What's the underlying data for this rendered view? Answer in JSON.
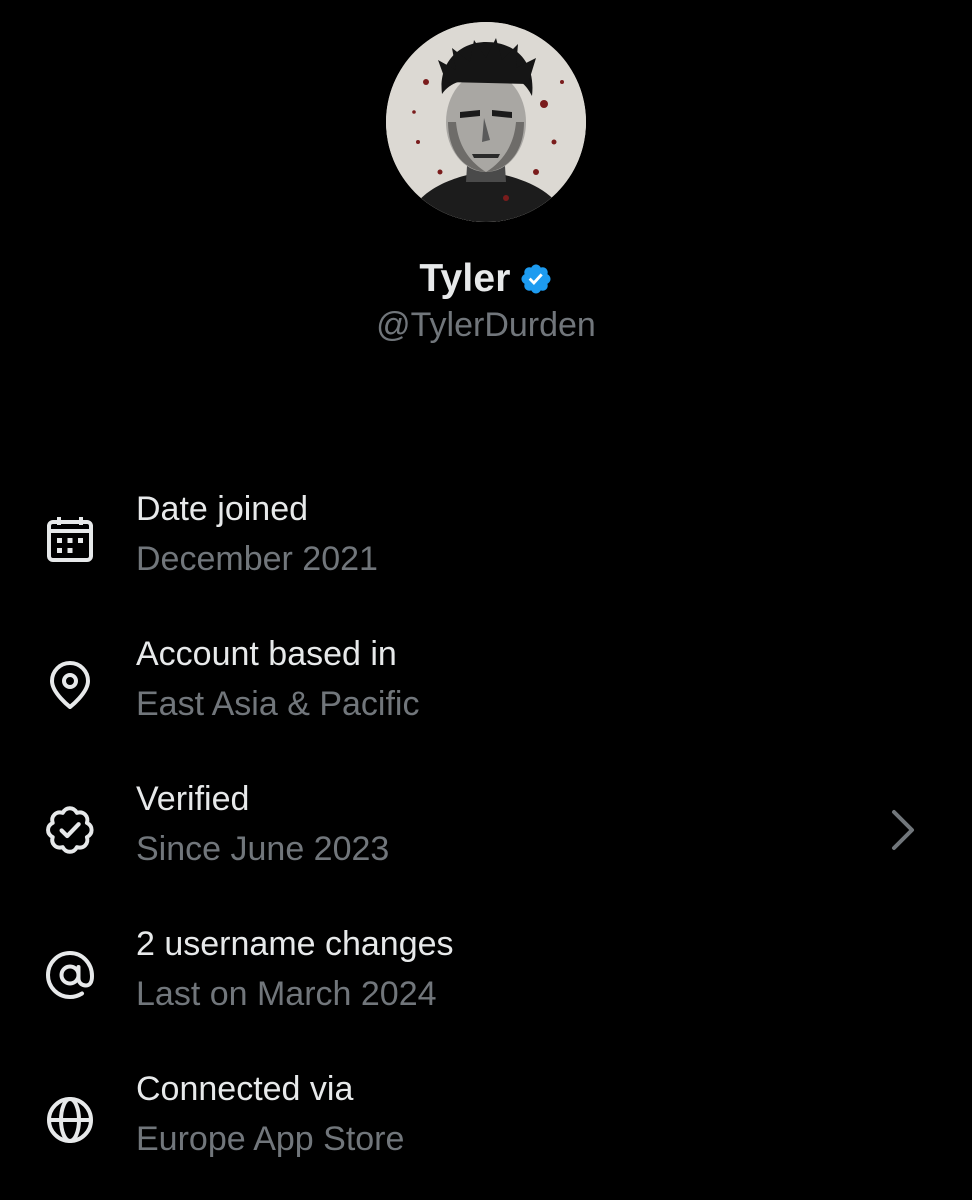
{
  "colors": {
    "background": "#000000",
    "primary_text": "#e7e9ea",
    "secondary_text": "#71767b",
    "verified_blue": "#1d9bf0"
  },
  "profile": {
    "display_name": "Tyler",
    "handle": "@TylerDurden",
    "verified_icon": "verified-badge-icon",
    "avatar_icon": "profile-avatar"
  },
  "about": {
    "items": [
      {
        "icon": "calendar-icon",
        "title": "Date joined",
        "value": "December 2021"
      },
      {
        "icon": "location-pin-icon",
        "title": "Account based in",
        "value": "East Asia & Pacific"
      },
      {
        "icon": "verified-outline-icon",
        "title": "Verified",
        "value": "Since June 2023",
        "has_chevron": true
      },
      {
        "icon": "at-sign-icon",
        "title": "2 username changes",
        "value": "Last on March 2024"
      },
      {
        "icon": "globe-icon",
        "title": "Connected via",
        "value": "Europe App Store"
      }
    ]
  }
}
